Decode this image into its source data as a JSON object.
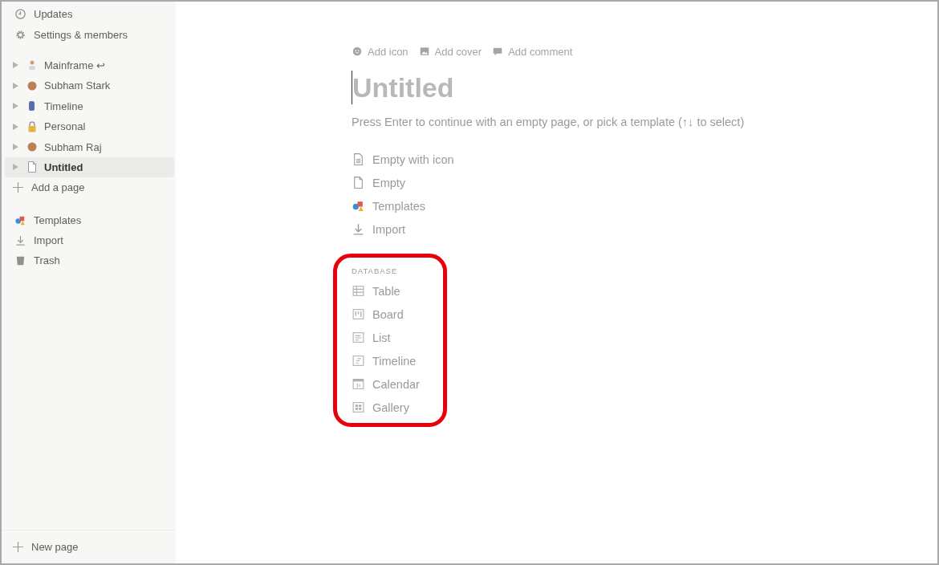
{
  "sidebar": {
    "top_items": [
      {
        "label": "Updates"
      },
      {
        "label": "Settings & members"
      }
    ],
    "pages": [
      {
        "label": "Mainframe",
        "suffix": "↩",
        "selected": false
      },
      {
        "label": "Subham Stark",
        "selected": false
      },
      {
        "label": "Timeline",
        "selected": false
      },
      {
        "label": "Personal",
        "selected": false
      },
      {
        "label": "Subham Raj",
        "selected": false
      },
      {
        "label": "Untitled",
        "selected": true
      }
    ],
    "add_page": "Add a page",
    "bottom_items": [
      {
        "label": "Templates"
      },
      {
        "label": "Import"
      },
      {
        "label": "Trash"
      }
    ],
    "new_page": "New page"
  },
  "page": {
    "actions": [
      {
        "label": "Add icon"
      },
      {
        "label": "Add cover"
      },
      {
        "label": "Add comment"
      }
    ],
    "title_placeholder": "Untitled",
    "hint": "Press Enter to continue with an empty page, or pick a template (↑↓ to select)",
    "options": [
      {
        "label": "Empty with icon"
      },
      {
        "label": "Empty"
      },
      {
        "label": "Templates"
      },
      {
        "label": "Import"
      }
    ],
    "database": {
      "heading": "DATABASE",
      "highlighted": true,
      "items": [
        {
          "label": "Table"
        },
        {
          "label": "Board"
        },
        {
          "label": "List"
        },
        {
          "label": "Timeline"
        },
        {
          "label": "Calendar"
        },
        {
          "label": "Gallery"
        }
      ]
    }
  }
}
